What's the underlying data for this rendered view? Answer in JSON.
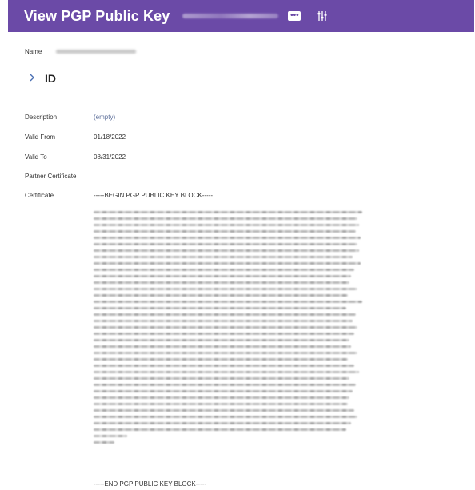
{
  "header": {
    "title": "View PGP Public Key",
    "more_glyph": "•••",
    "more_icon": "more-horizontal-icon",
    "filter_icon": "related-actions-icon",
    "bg_color": "#6b4aa7"
  },
  "fields": {
    "name_label": "Name",
    "id_label": "ID",
    "description_label": "Description",
    "description_value": "(empty)",
    "valid_from_label": "Valid From",
    "valid_from_value": "01/18/2022",
    "valid_to_label": "Valid To",
    "valid_to_value": "08/31/2022",
    "partner_certificate_label": "Partner Certificate",
    "certificate_label": "Certificate",
    "certificate_begin": "-----BEGIN PGP PUBLIC KEY BLOCK-----",
    "certificate_end": "-----END PGP PUBLIC KEY BLOCK-----"
  },
  "icons": {
    "id_expand": "chevron-right-icon"
  }
}
